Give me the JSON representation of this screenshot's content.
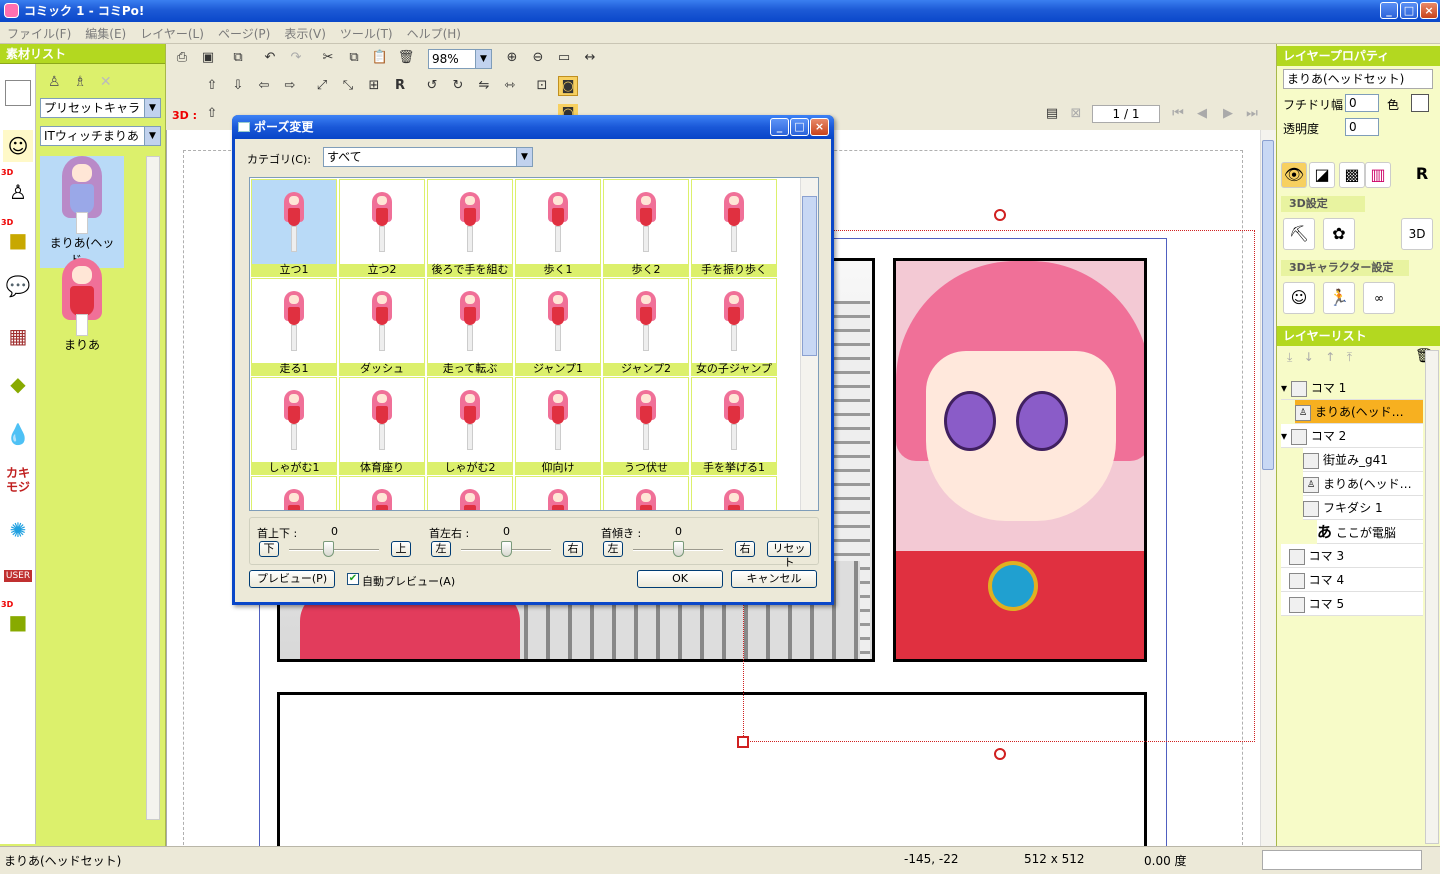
{
  "window": {
    "title": "コミック 1 - コミPo!"
  },
  "menu": [
    "ファイル(F)",
    "編集(E)",
    "レイヤー(L)",
    "ページ(P)",
    "表示(V)",
    "ツール(T)",
    "ヘルプ(H)"
  ],
  "left_panel": {
    "header": "素材リスト",
    "preset_select": "プリセットキャラ",
    "char_select": "ITウィッチまりあ",
    "items": [
      {
        "label": "まりあ(ヘッド…"
      },
      {
        "label": "まりあ"
      }
    ],
    "tag_3d": "3D",
    "tag_user": "USER"
  },
  "toolbar": {
    "zoom": "98%",
    "label_3d": "3D :",
    "page": "1 / 1"
  },
  "dialog": {
    "title": "ポーズ変更",
    "category_label": "カテゴリ(C):",
    "category_value": "すべて",
    "poses": [
      "立つ1",
      "立つ2",
      "後ろで手を組む",
      "歩く1",
      "歩く2",
      "手を振り歩く",
      "走る1",
      "ダッシュ",
      "走って転ぶ",
      "ジャンプ1",
      "ジャンプ2",
      "女の子ジャンプ",
      "しゃがむ1",
      "体育座り",
      "しゃがむ2",
      "仰向け",
      "うつ伏せ",
      "手を挙げる1"
    ],
    "neck_ud_label": "首上下 :",
    "neck_lr_label": "首左右 :",
    "neck_tilt_label": "首傾き :",
    "neck_ud_value": "0",
    "neck_lr_value": "0",
    "neck_tilt_value": "0",
    "btn_down": "下",
    "btn_up": "上",
    "btn_left": "左",
    "btn_right": "右",
    "btn_reset": "リセット",
    "btn_preview": "プレビュー(P)",
    "auto_preview": "自動プレビュー(A)",
    "btn_ok": "OK",
    "btn_cancel": "キャンセル"
  },
  "right_panel": {
    "props_header": "レイヤープロパティ",
    "layer_name": "まりあ(ヘッドセット)",
    "border_width_label": "フチドリ幅",
    "border_width_value": "0",
    "color_label": "色",
    "opacity_label": "透明度",
    "opacity_value": "0",
    "sec_3d": "3D設定",
    "sec_3d_char": "3Dキャラクター設定",
    "list_header": "レイヤーリスト",
    "layers": [
      {
        "label": "コマ 1"
      },
      {
        "label": "まりあ(ヘッド…"
      },
      {
        "label": "コマ 2"
      },
      {
        "label": "街並み_g41"
      },
      {
        "label": "まりあ(ヘッド…"
      },
      {
        "label": "フキダシ 1"
      },
      {
        "label": "ここが電脳"
      },
      {
        "label": "コマ 3"
      },
      {
        "label": "コマ 4"
      },
      {
        "label": "コマ 5"
      }
    ]
  },
  "status": {
    "selection": "まりあ(ヘッドセット)",
    "coords": "-145, -22",
    "size": "512 x 512",
    "angle": "0.00 度"
  },
  "colors": {
    "accent_green": "#b3d820",
    "panel_green": "#dcf06c",
    "xp_blue": "#0a47c9",
    "hair_pink": "#f07098",
    "selection_orange": "#f7b020"
  }
}
